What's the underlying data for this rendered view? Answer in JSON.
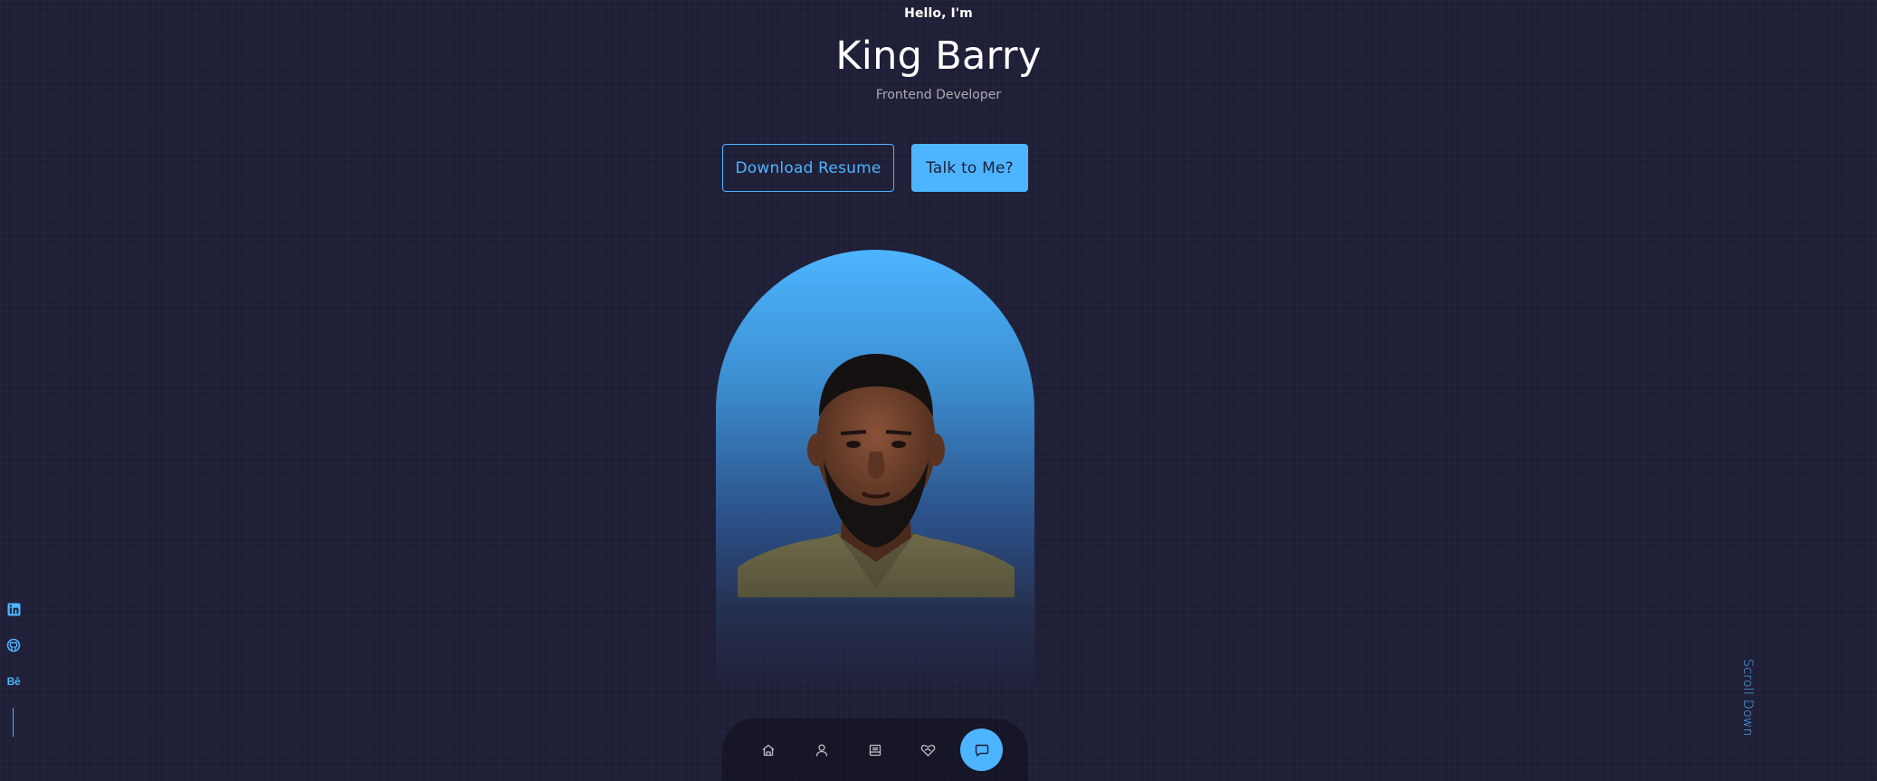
{
  "header": {
    "greeting": "Hello, I'm",
    "name": "King Barry",
    "role": "Frontend Developer"
  },
  "cta": {
    "download_label": "Download Resume",
    "talk_label": "Talk to Me?"
  },
  "socials": {
    "items": [
      {
        "icon": "linkedin-icon"
      },
      {
        "icon": "github-icon"
      },
      {
        "icon": "behance-icon",
        "label": "Bē"
      }
    ]
  },
  "scroll": {
    "label": "Scroll Down"
  },
  "nav": {
    "items": [
      {
        "icon": "home-icon",
        "active": false
      },
      {
        "icon": "user-icon",
        "active": false
      },
      {
        "icon": "book-icon",
        "active": false
      },
      {
        "icon": "services-icon",
        "active": false
      },
      {
        "icon": "message-icon",
        "active": true
      }
    ]
  },
  "colors": {
    "background": "#1f1f38",
    "accent": "#4db5ff",
    "text": "#ffffff"
  }
}
